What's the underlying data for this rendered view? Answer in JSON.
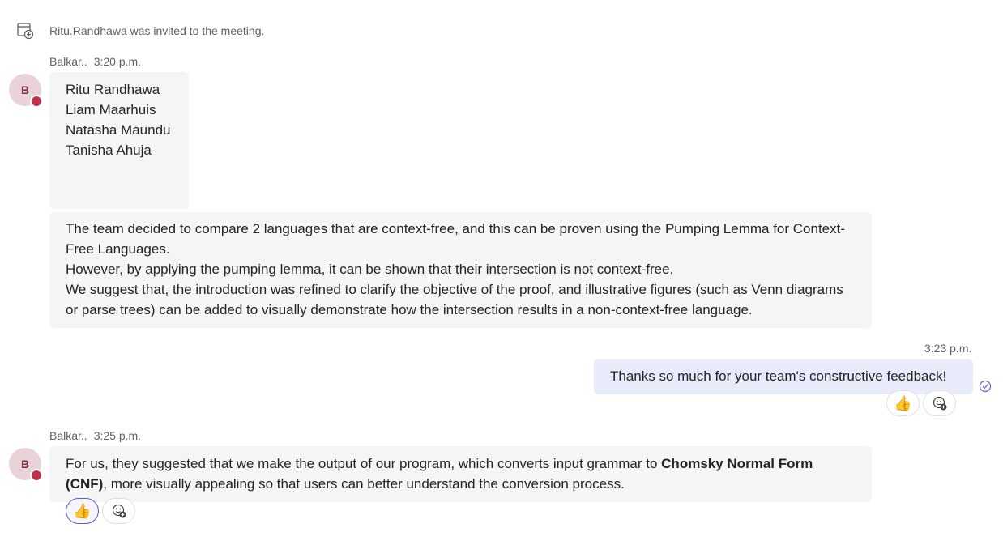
{
  "system_message": {
    "text": "Ritu.Randhawa was invited to the meeting.",
    "icon": "calendar-add-icon"
  },
  "messages": [
    {
      "sender": "Balkar..",
      "time": "3:20 p.m.",
      "avatar_initial": "B",
      "names": [
        "Ritu Randhawa",
        "Liam Maarhuis",
        "Natasha Maundu",
        "Tanisha Ahuja"
      ],
      "long_text": [
        "The team  decided to compare 2  languages that are context-free, and this can be proven using the Pumping Lemma for Context-Free Languages.",
        "However, by applying the pumping lemma, it can be shown that their intersection is not context-free.",
        "We suggest that, the introduction was refined to clarify the objective of the proof, and illustrative figures (such as Venn diagrams or parse trees) can be added to visually demonstrate how the intersection results in a non-context-free language."
      ]
    },
    {
      "time": "3:23 p.m.",
      "text": "Thanks so much for your team's constructive feedback!",
      "reaction_emoji": "👍"
    },
    {
      "sender": "Balkar..",
      "time": "3:25 p.m.",
      "avatar_initial": "B",
      "text_before": "For us, they suggested that we make the output of our program, which converts input grammar to ",
      "text_bold": "Chomsky Normal Form (CNF)",
      "text_after": ", more visually appealing so that users can better understand the conversion process.",
      "reaction_emoji": "👍"
    }
  ],
  "colors": {
    "accent": "#5b5fc7",
    "presence_busy": "#c4314b",
    "my_bubble": "#e8ebfa",
    "other_bubble": "#f5f5f5"
  }
}
